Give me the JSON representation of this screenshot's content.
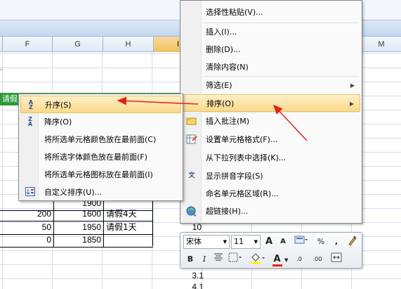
{
  "columns": [
    {
      "label": "F",
      "selected": false
    },
    {
      "label": "G",
      "selected": false
    },
    {
      "label": "H",
      "selected": false
    },
    {
      "label": "I",
      "selected": true
    },
    {
      "label": "M",
      "selected": false
    }
  ],
  "sheet": {
    "header_cell": "请假",
    "rows": [
      {
        "a": "",
        "b": "1900",
        "c": ""
      },
      {
        "a": "200",
        "b": "1600",
        "c": "请假4天"
      },
      {
        "a": "50",
        "b": "1950",
        "c": "请假1天"
      },
      {
        "a": "0",
        "b": "1850",
        "c": ""
      }
    ],
    "cell_i": "10",
    "cell_j": "3.1",
    "cell_k": "4.1"
  },
  "context_menu": {
    "items": [
      {
        "label": "选择性粘贴(V)...",
        "icon": "paste-special-icon",
        "has_sub": false,
        "highlight": false
      },
      {
        "label": "插入(I)...",
        "icon": "",
        "has_sub": false,
        "highlight": false
      },
      {
        "label": "删除(D)...",
        "icon": "",
        "has_sub": false,
        "highlight": false
      },
      {
        "label": "清除内容(N)",
        "icon": "",
        "has_sub": false,
        "highlight": false
      },
      {
        "label": "筛选(E)",
        "icon": "",
        "has_sub": true,
        "highlight": false
      },
      {
        "label": "排序(O)",
        "icon": "",
        "has_sub": true,
        "highlight": true
      },
      {
        "label": "插入批注(M)",
        "icon": "insert-comment-icon",
        "has_sub": false,
        "highlight": false
      },
      {
        "label": "设置单元格格式(F)...",
        "icon": "format-cells-icon",
        "has_sub": false,
        "highlight": false
      },
      {
        "label": "从下拉列表中选择(K)...",
        "icon": "",
        "has_sub": false,
        "highlight": false
      },
      {
        "label": "显示拼音字段(S)",
        "icon": "phonetic-icon",
        "has_sub": false,
        "highlight": false
      },
      {
        "label": "命名单元格区域(R)...",
        "icon": "",
        "has_sub": false,
        "highlight": false
      },
      {
        "label": "超链接(H)...",
        "icon": "hyperlink-icon",
        "has_sub": false,
        "highlight": false
      }
    ]
  },
  "sort_submenu": {
    "items": [
      {
        "label": "升序(S)",
        "icon": "sort-ascending-icon",
        "highlight": true
      },
      {
        "label": "降序(O)",
        "icon": "sort-descending-icon",
        "highlight": false
      },
      {
        "label": "将所选单元格颜色放在最前面(C)",
        "icon": "",
        "highlight": false
      },
      {
        "label": "将所选字体颜色放在最前面(F)",
        "icon": "",
        "highlight": false
      },
      {
        "label": "将所选单元格图标放在最前面(I)",
        "icon": "",
        "highlight": false
      },
      {
        "label": "自定义排序(U)...",
        "icon": "custom-sort-icon",
        "highlight": false
      }
    ]
  },
  "mini_toolbar": {
    "font_name": "宋体",
    "font_size": "11",
    "grow_font": "A",
    "shrink_font": "A",
    "percent": "%",
    "comma": ",",
    "bold": "B",
    "italic": "I",
    "font_color_letter": "A",
    "decimal_increase": ".0",
    "decimal_decrease": ".00"
  },
  "colors": {
    "highlight": "#fbd98a",
    "annotation_arrow": "#e0231c",
    "header_green": "#2e9b3c"
  }
}
